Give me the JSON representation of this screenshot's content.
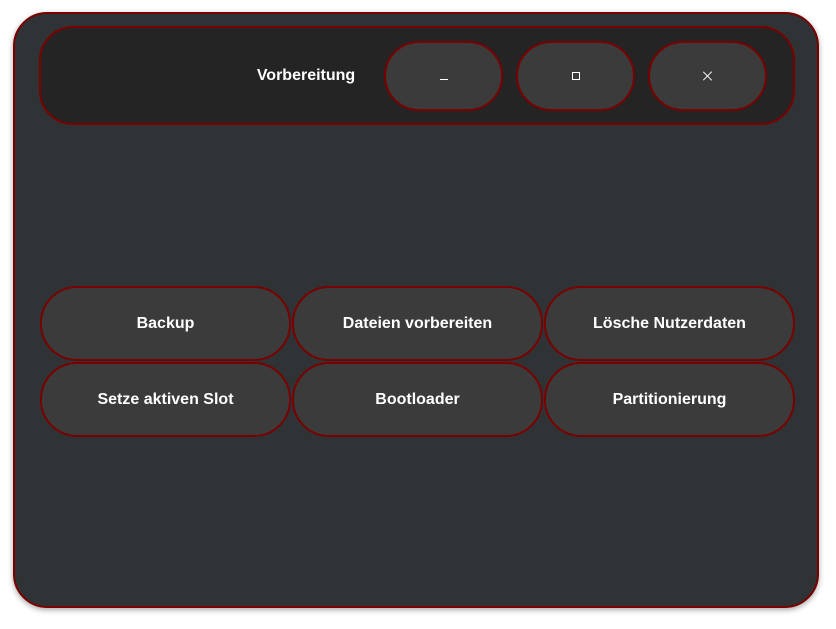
{
  "window": {
    "title": "Vorbereitung",
    "controls": {
      "minimize_icon": "minimize-icon",
      "maximize_icon": "maximize-icon",
      "close_icon": "close-icon"
    }
  },
  "actions": [
    {
      "label": "Backup"
    },
    {
      "label": "Dateien vorbereiten"
    },
    {
      "label": "Lösche Nutzerdaten"
    },
    {
      "label": "Setze aktiven Slot"
    },
    {
      "label": "Bootloader"
    },
    {
      "label": "Partitionierung"
    }
  ],
  "colors": {
    "background": "#303336",
    "titlebar": "#242424",
    "button": "#3b3b3b",
    "border": "#7a0000",
    "text": "#ffffff"
  }
}
